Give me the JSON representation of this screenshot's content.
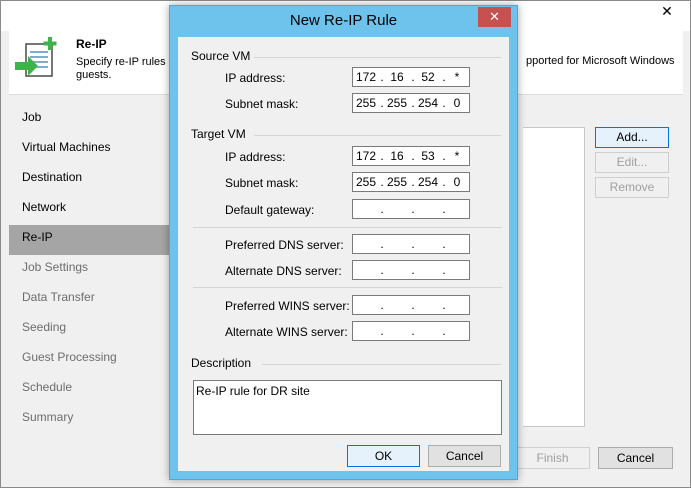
{
  "wizard": {
    "close_glyph": "✕",
    "header": {
      "title": "Re-IP",
      "desc_left": "Specify re-IP rules to",
      "desc_right": "pported for Microsoft Windows",
      "desc_line2": "guests.",
      "icon": "re-ip-icon"
    },
    "steps": [
      {
        "label": "Job",
        "state": "normal"
      },
      {
        "label": "Virtual Machines",
        "state": "normal"
      },
      {
        "label": "Destination",
        "state": "normal"
      },
      {
        "label": "Network",
        "state": "normal"
      },
      {
        "label": "Re-IP",
        "state": "active"
      },
      {
        "label": "Job Settings",
        "state": "disabled"
      },
      {
        "label": "Data Transfer",
        "state": "disabled"
      },
      {
        "label": "Seeding",
        "state": "disabled"
      },
      {
        "label": "Guest Processing",
        "state": "disabled"
      },
      {
        "label": "Schedule",
        "state": "disabled"
      },
      {
        "label": "Summary",
        "state": "disabled"
      }
    ],
    "buttons": {
      "add": "Add...",
      "edit": "Edit...",
      "remove": "Remove",
      "finish": "Finish",
      "cancel": "Cancel"
    }
  },
  "dialog": {
    "title": "New Re-IP Rule",
    "close_glyph": "✕",
    "source_vm": {
      "label": "Source VM",
      "ip_label": "IP address:",
      "ip": [
        "172",
        "16",
        "52",
        "*"
      ],
      "mask_label": "Subnet mask:",
      "mask": [
        "255",
        "255",
        "254",
        "0"
      ]
    },
    "target_vm": {
      "label": "Target VM",
      "ip_label": "IP address:",
      "ip": [
        "172",
        "16",
        "53",
        "*"
      ],
      "mask_label": "Subnet mask:",
      "mask": [
        "255",
        "255",
        "254",
        "0"
      ],
      "gateway_label": "Default gateway:",
      "gateway": [
        "",
        "",
        "",
        ""
      ],
      "pref_dns_label": "Preferred DNS server:",
      "pref_dns": [
        "",
        "",
        "",
        ""
      ],
      "alt_dns_label": "Alternate DNS server:",
      "alt_dns": [
        "",
        "",
        "",
        ""
      ],
      "pref_wins_label": "Preferred WINS server:",
      "pref_wins": [
        "",
        "",
        "",
        ""
      ],
      "alt_wins_label": "Alternate WINS server:",
      "alt_wins": [
        "",
        "",
        "",
        ""
      ]
    },
    "description": {
      "label": "Description",
      "value": "Re-IP rule for DR site"
    },
    "ok_label": "OK",
    "cancel_label": "Cancel"
  },
  "colors": {
    "dialog_frame": "#6ec3ec",
    "close_button": "#c75050",
    "active_step": "#a5a5a5"
  }
}
